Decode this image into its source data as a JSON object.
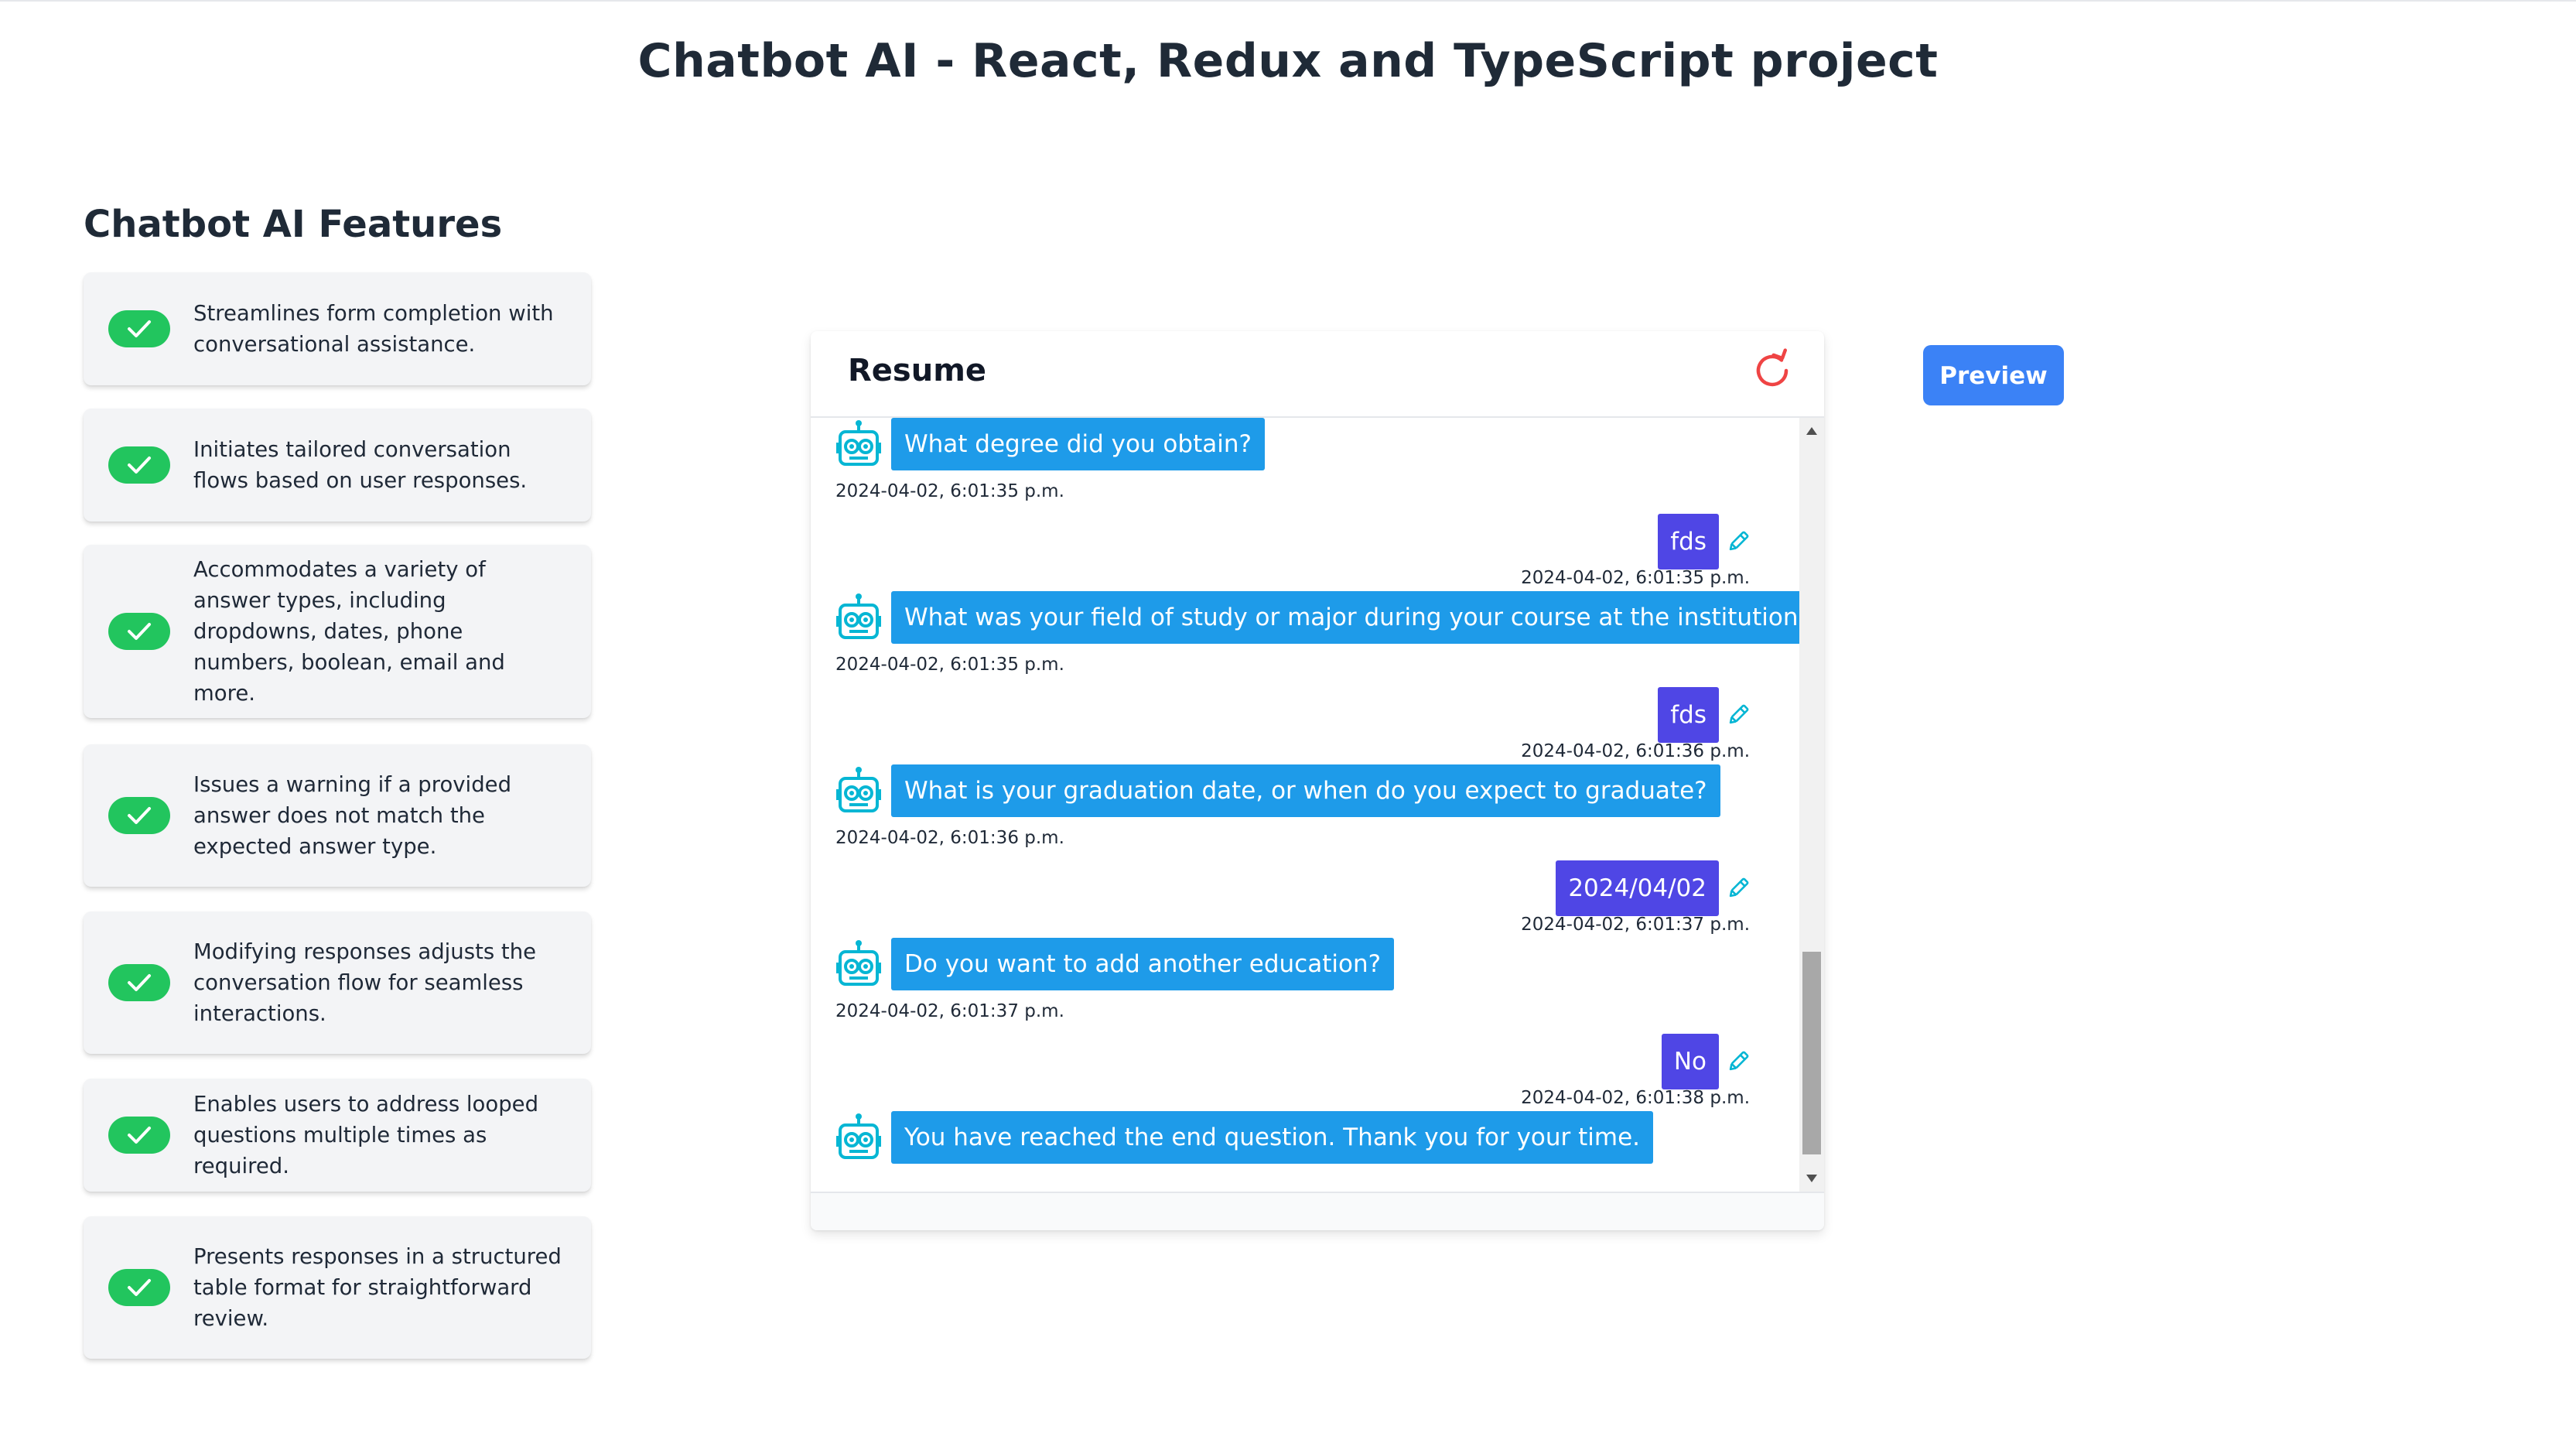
{
  "page": {
    "title": "Chatbot AI - React, Redux and TypeScript project"
  },
  "features": {
    "title": "Chatbot AI Features",
    "items": [
      {
        "text": "Streamlines form completion with conversational assistance."
      },
      {
        "text": "Initiates tailored conversation flows based on user responses."
      },
      {
        "text": "Accommodates a variety of answer types, including dropdowns, dates, phone numbers, boolean, email and more."
      },
      {
        "text": "Issues a warning if a provided answer does not match the expected answer type."
      },
      {
        "text": "Modifying responses adjusts the conversation flow for seamless interactions."
      },
      {
        "text": "Enables users to address looped questions multiple times as required."
      },
      {
        "text": "Presents responses in a structured table format for straightforward review."
      }
    ],
    "check_color": "#22c55e"
  },
  "chat": {
    "title": "Resume",
    "reset_icon": "refresh-icon",
    "bot_icon": "robot-icon",
    "edit_icon": "pencil-icon",
    "colors": {
      "bot_bubble": "#1e9be9",
      "user_bubble": "#4f46e5",
      "accent": "#06b6d4",
      "reset": "#ef4444"
    },
    "messages": [
      {
        "from": "bot",
        "text": "What degree did you obtain?",
        "time": "2024-04-02, 6:01:35 p.m."
      },
      {
        "from": "user",
        "text": "fds",
        "time": "2024-04-02, 6:01:35 p.m."
      },
      {
        "from": "bot",
        "text": "What was your field of study or major during your course at the institution?",
        "time": "2024-04-02, 6:01:35 p.m."
      },
      {
        "from": "user",
        "text": "fds",
        "time": "2024-04-02, 6:01:36 p.m."
      },
      {
        "from": "bot",
        "text": "What is your graduation date, or when do you expect to graduate?",
        "time": "2024-04-02, 6:01:36 p.m."
      },
      {
        "from": "user",
        "text": "2024/04/02",
        "time": "2024-04-02, 6:01:37 p.m."
      },
      {
        "from": "bot",
        "text": "Do you want to add another education?",
        "time": "2024-04-02, 6:01:37 p.m."
      },
      {
        "from": "user",
        "text": "No",
        "time": "2024-04-02, 6:01:38 p.m."
      },
      {
        "from": "bot",
        "text": "You have reached the end question. Thank you for your time."
      }
    ]
  },
  "actions": {
    "preview_label": "Preview"
  }
}
